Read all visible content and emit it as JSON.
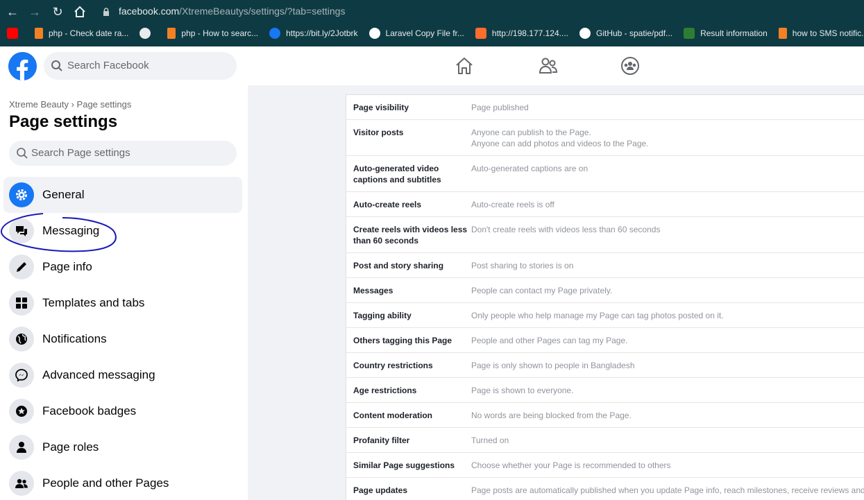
{
  "browser": {
    "url_host": "facebook.com",
    "url_path": "/XtremeBeautys/settings/?tab=settings",
    "bookmarks": [
      {
        "label": "",
        "icon": "youtube-icon",
        "color": "#ff0000"
      },
      {
        "label": "php - Check date ra...",
        "icon": "stackoverflow-icon",
        "color": "#f48024"
      },
      {
        "label": "",
        "icon": "globe-icon",
        "color": "#e8eaed"
      },
      {
        "label": "php - How to searc...",
        "icon": "stackoverflow-icon",
        "color": "#f48024"
      },
      {
        "label": "https://bit.ly/2Jotbrk",
        "icon": "facebook-icon",
        "color": "#1877f2"
      },
      {
        "label": "Laravel Copy File fr...",
        "icon": "dev-icon",
        "color": "#ffffff"
      },
      {
        "label": "http://198.177.124....",
        "icon": "cpanel-icon",
        "color": "#ff6c2c"
      },
      {
        "label": "GitHub - spatie/pdf...",
        "icon": "github-icon",
        "color": "#ffffff"
      },
      {
        "label": "Result information",
        "icon": "result-icon",
        "color": "#2e7d32"
      },
      {
        "label": "how to SMS notific...",
        "icon": "stackoverflow-icon",
        "color": "#f48024"
      }
    ]
  },
  "header": {
    "search_placeholder": "Search Facebook"
  },
  "sidebar": {
    "breadcrumb": "Xtreme Beauty › Page settings",
    "title": "Page settings",
    "search_placeholder": "Search Page settings",
    "items": [
      {
        "label": "General",
        "icon": "gear-icon"
      },
      {
        "label": "Messaging",
        "icon": "chat-bubbles-icon"
      },
      {
        "label": "Page info",
        "icon": "pencil-icon"
      },
      {
        "label": "Templates and tabs",
        "icon": "grid-icon"
      },
      {
        "label": "Notifications",
        "icon": "globe-icon"
      },
      {
        "label": "Advanced messaging",
        "icon": "messenger-icon"
      },
      {
        "label": "Facebook badges",
        "icon": "badge-icon"
      },
      {
        "label": "Page roles",
        "icon": "person-icon"
      },
      {
        "label": "People and other Pages",
        "icon": "people-icon"
      }
    ]
  },
  "settings": [
    {
      "key": "Page visibility",
      "value": "Page published"
    },
    {
      "key": "Visitor posts",
      "value": "Anyone can publish to the Page.",
      "value2": "Anyone can add photos and videos to the Page."
    },
    {
      "key": "Auto-generated video captions and subtitles",
      "value": "Auto-generated captions are on"
    },
    {
      "key": "Auto-create reels",
      "value": "Auto-create reels is off"
    },
    {
      "key": "Create reels with videos less than 60 seconds",
      "value": "Don't create reels with videos less than 60 seconds"
    },
    {
      "key": "Post and story sharing",
      "value": "Post sharing to stories is on"
    },
    {
      "key": "Messages",
      "value": "People can contact my Page privately."
    },
    {
      "key": "Tagging ability",
      "value": "Only people who help manage my Page can tag photos posted on it."
    },
    {
      "key": "Others tagging this Page",
      "value": "People and other Pages can tag my Page."
    },
    {
      "key": "Country restrictions",
      "value": "Page is only shown to people in Bangladesh"
    },
    {
      "key": "Age restrictions",
      "value": "Page is shown to everyone."
    },
    {
      "key": "Content moderation",
      "value": "No words are being blocked from the Page."
    },
    {
      "key": "Profanity filter",
      "value": "Turned on"
    },
    {
      "key": "Similar Page suggestions",
      "value": "Choose whether your Page is recommended to others"
    },
    {
      "key": "Page updates",
      "value": "Page posts are automatically published when you update Page info, reach milestones, receive reviews and"
    }
  ]
}
